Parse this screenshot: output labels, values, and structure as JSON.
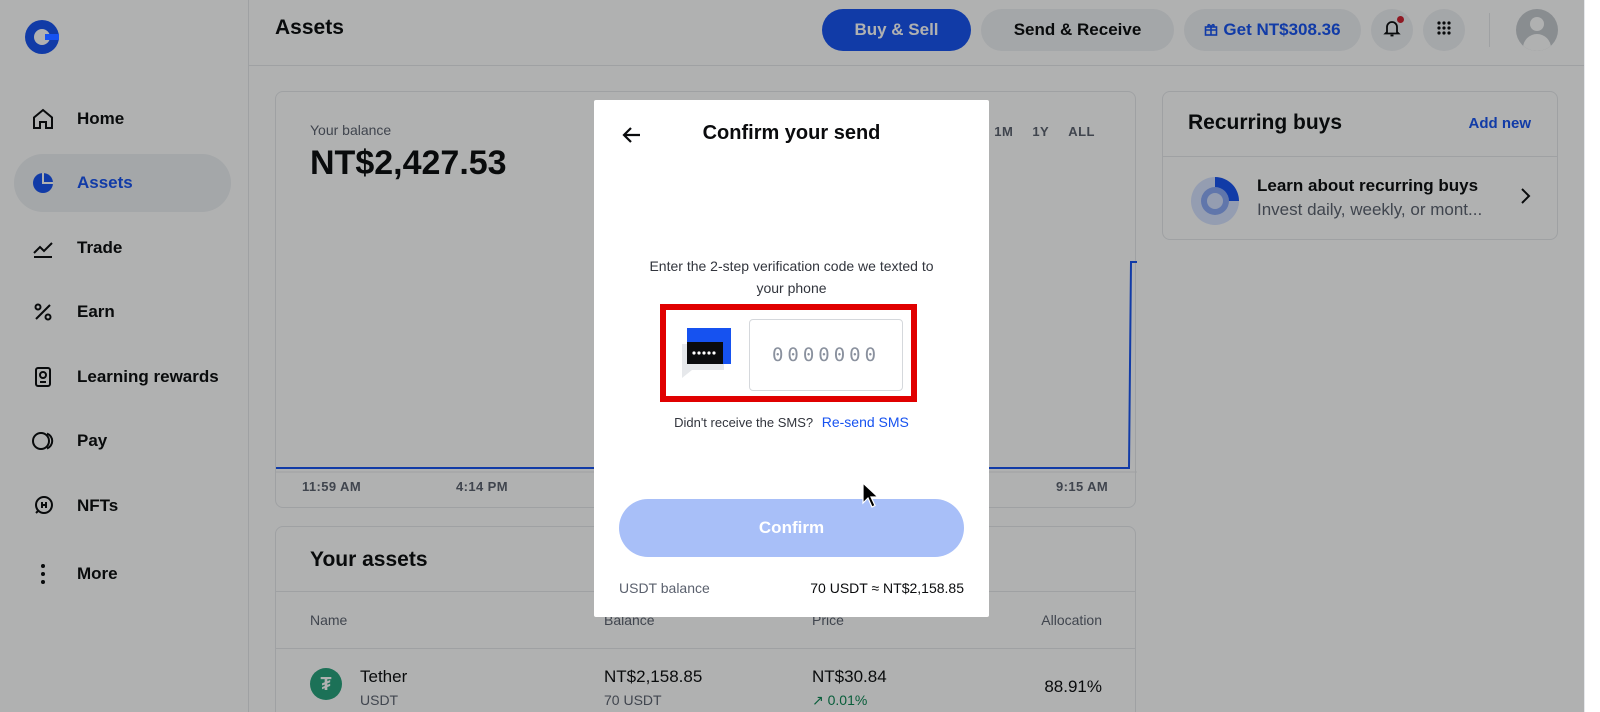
{
  "sidebar": {
    "items": [
      {
        "label": "Home",
        "icon": "home-icon"
      },
      {
        "label": "Assets",
        "icon": "pie-chart-icon",
        "active": true
      },
      {
        "label": "Trade",
        "icon": "trend-chart-icon"
      },
      {
        "label": "Earn",
        "icon": "percent-icon"
      },
      {
        "label": "Learning rewards",
        "icon": "learning-reward-icon"
      },
      {
        "label": "Pay",
        "icon": "pay-icon"
      },
      {
        "label": "NFTs",
        "icon": "nft-icon"
      },
      {
        "label": "More",
        "icon": "more-vertical-icon"
      }
    ]
  },
  "header": {
    "title": "Assets",
    "buy_sell": "Buy & Sell",
    "send_receive": "Send & Receive",
    "get_reward": "Get NT$308.36"
  },
  "balance": {
    "label": "Your balance",
    "value": "NT$2,427.53",
    "ranges": [
      "1M",
      "1Y",
      "ALL"
    ],
    "time_labels": [
      "11:59 AM",
      "4:14 PM",
      "9:15 AM"
    ]
  },
  "recurring": {
    "title": "Recurring buys",
    "add_new": "Add new",
    "item_title": "Learn about recurring buys",
    "item_sub": "Invest daily, weekly, or mont..."
  },
  "assets": {
    "title": "Your assets",
    "columns": [
      "Name",
      "Balance",
      "Price",
      "Allocation"
    ],
    "rows": [
      {
        "name": "Tether",
        "symbol": "USDT",
        "balance": "NT$2,158.85",
        "balance_sub": "70 USDT",
        "price": "NT$30.84",
        "change": "↗ 0.01%",
        "allocation": "88.91%"
      }
    ]
  },
  "modal": {
    "title": "Confirm your send",
    "instruction": "Enter the 2-step verification code we texted to your phone",
    "code_placeholder": "0000000",
    "sms_prompt": "Didn't receive the SMS?",
    "resend": "Re-send SMS",
    "confirm": "Confirm",
    "footer_label": "USDT balance",
    "footer_value": "70 USDT ≈ NT$2,158.85"
  },
  "colors": {
    "brand_blue": "#1652f0",
    "confirm_disabled": "#a8bff8",
    "highlight_red": "#e00000",
    "positive_green": "#098551"
  }
}
